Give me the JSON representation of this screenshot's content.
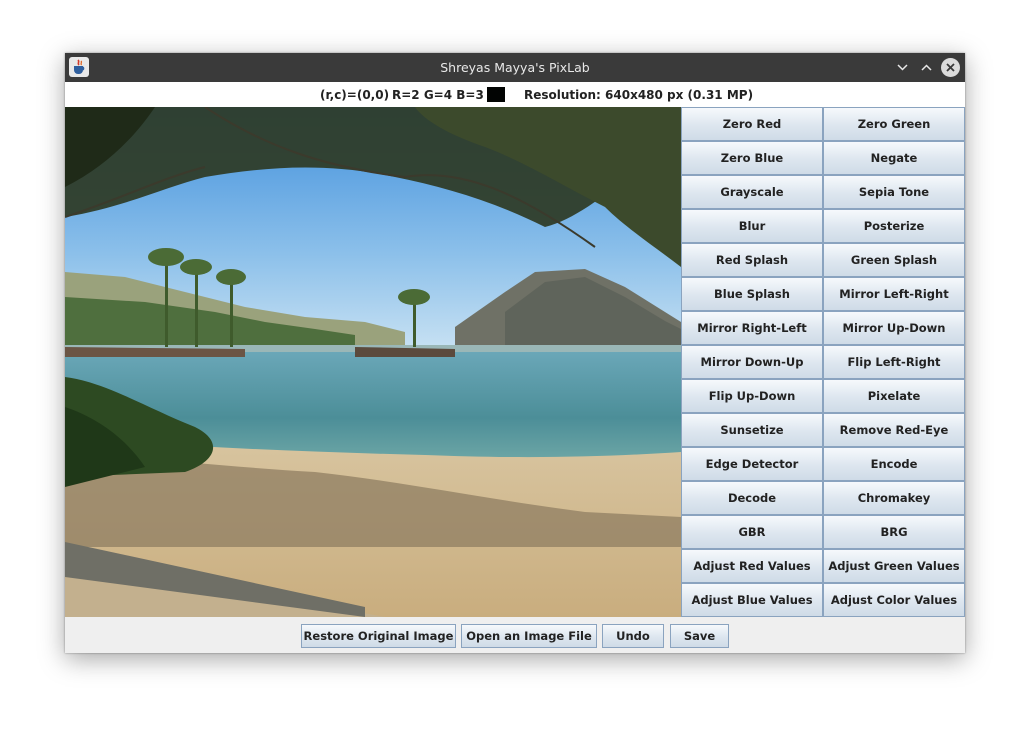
{
  "window": {
    "title": "Shreyas Mayya's PixLab",
    "icon": "java-cup-icon",
    "controls": [
      "minimize-icon",
      "maximize-icon",
      "close-icon"
    ]
  },
  "status": {
    "coordinates": "(r,c)=(0,0)",
    "rgb": "R=2  G=4  B=3",
    "swatch_color": "#020403",
    "resolution": "Resolution: 640x480 px (0.31 MP)"
  },
  "image": {
    "subject": "beach-landscape-photo"
  },
  "filters": [
    "Zero Red",
    "Zero Green",
    "Zero Blue",
    "Negate",
    "Grayscale",
    "Sepia Tone",
    "Blur",
    "Posterize",
    "Red Splash",
    "Green Splash",
    "Blue Splash",
    "Mirror Left-Right",
    "Mirror Right-Left",
    "Mirror Up-Down",
    "Mirror Down-Up",
    "Flip Left-Right",
    "Flip Up-Down",
    "Pixelate",
    "Sunsetize",
    "Remove Red-Eye",
    "Edge Detector",
    "Encode",
    "Decode",
    "Chromakey",
    "GBR",
    "BRG",
    "Adjust Red Values",
    "Adjust Green Values",
    "Adjust Blue Values",
    "Adjust Color Values"
  ],
  "bottom": {
    "restore": "Restore Original Image",
    "open": "Open an Image File",
    "undo": "Undo",
    "save": "Save"
  }
}
